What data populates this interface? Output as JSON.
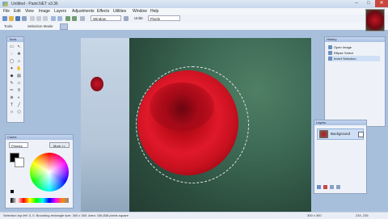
{
  "window": {
    "title": "Untitled - Paint.NET v3.36",
    "min": "–",
    "max": "□",
    "close": "✕"
  },
  "menu": [
    "File",
    "Edit",
    "View",
    "Image",
    "Layers",
    "Adjustments",
    "Effects",
    "Utilities",
    "Window",
    "Help"
  ],
  "toolbar": {
    "window_label": "Window",
    "units_label": "Units:",
    "units_value": "Pixels"
  },
  "toolbar2": {
    "tool_label": "Tools",
    "mode_label": "Selection Mode:"
  },
  "panels": {
    "tools_title": "Tools",
    "colors_title": "Colors",
    "colors_primary": "Primary",
    "colors_more": "More >>",
    "history_title": "History",
    "layers_title": "Layers"
  },
  "history": {
    "items": [
      "Open Image",
      "Ellipse Select",
      "Invert Selection"
    ]
  },
  "layers": {
    "items": [
      {
        "name": "Background"
      }
    ]
  },
  "status": {
    "left": "Selection top left: 0, 0. Bounding rectangle size: 300 x 300. Area: 156,838 pixels square",
    "size": "300 x 300",
    "coords": "234, 235"
  },
  "colors": {
    "accent": "#c9463d",
    "titlebar": "#c7d7ec"
  }
}
